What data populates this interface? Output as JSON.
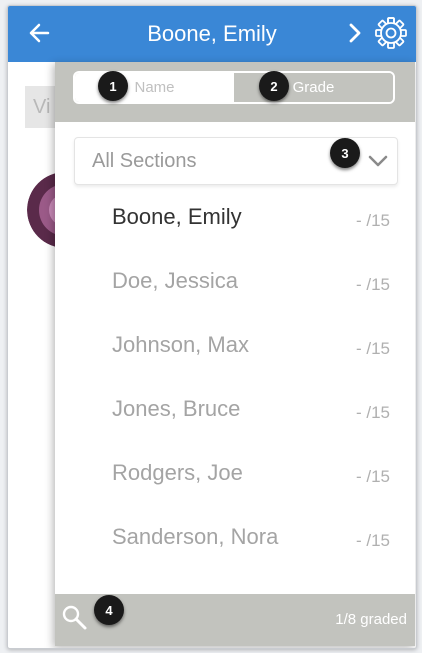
{
  "header": {
    "title": "Boone, Emily"
  },
  "background": {
    "view_button_label": "Vi"
  },
  "sort": {
    "name_label": "Name",
    "grade_label": "Grade",
    "selected": "Grade"
  },
  "sections": {
    "selected": "All Sections"
  },
  "students": [
    {
      "name": "Boone, Emily",
      "grade": "- /15",
      "current": true
    },
    {
      "name": "Doe, Jessica",
      "grade": "- /15"
    },
    {
      "name": "Johnson, Max",
      "grade": "- /15"
    },
    {
      "name": "Jones, Bruce",
      "grade": "- /15"
    },
    {
      "name": "Rodgers, Joe",
      "grade": "- /15"
    },
    {
      "name": "Sanderson, Nora",
      "grade": "- /15"
    }
  ],
  "footer": {
    "graded": "1/8 graded"
  },
  "markers": [
    "1",
    "2",
    "3",
    "4"
  ],
  "colors": {
    "accent": "#3a87d6",
    "panel_gray": "#c2c3be",
    "marker": "#1a1a1a"
  }
}
